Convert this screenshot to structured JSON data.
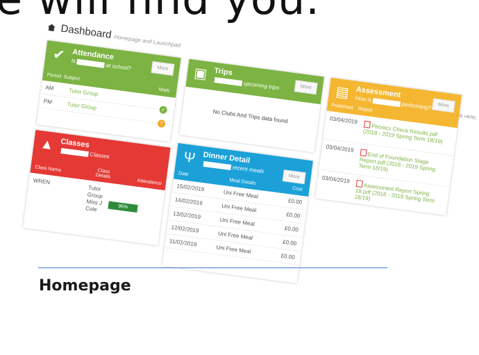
{
  "headline": "e will find you.",
  "dashboard": {
    "title": "Dashboard",
    "subtitle": "Homepage and Launchpad",
    "breadcrumb": "YOU ARE HERE:"
  },
  "attendance": {
    "title": "Attendance",
    "subtitle_pre": "Is",
    "subtitle_post": "at school?",
    "more": "More",
    "col_period": "Period",
    "col_subject": "Subject",
    "col_mark": "Mark",
    "rows": [
      {
        "period": "AM",
        "subject": "Tutor Group",
        "mark_icon": "check-icon",
        "color": "#7cb342"
      },
      {
        "period": "PM",
        "subject": "Tutor Group",
        "mark_icon": "question-icon",
        "color": "#f5a623"
      }
    ]
  },
  "classes": {
    "title": "Classes",
    "subtitle_post": "Classes",
    "col_name": "Class Name",
    "col_details": "Class Details",
    "col_attendance": "Attendance",
    "row": {
      "name": "WREN",
      "d1": "Tutor",
      "d2": "Group",
      "d3": "Miss J",
      "d4": "Cole",
      "attendance": "96%",
      "attendance_value": 96
    }
  },
  "trips": {
    "title": "Trips",
    "subtitle_post": "upcoming trips",
    "more": "More",
    "empty": "No Clubs And Trips data found"
  },
  "dinner": {
    "title": "Dinner Detail",
    "subtitle_post": "recent meals",
    "more": "More",
    "col_date": "Date",
    "col_meal": "Meal Details",
    "col_cost": "Cost",
    "rows": [
      {
        "date": "15/02/2019",
        "meal": "Uni Free Meal",
        "cost": "£0.00"
      },
      {
        "date": "14/02/2019",
        "meal": "Uni Free Meal",
        "cost": "£0.00"
      },
      {
        "date": "13/02/2019",
        "meal": "Uni Free Meal",
        "cost": "£0.00"
      },
      {
        "date": "12/02/2019",
        "meal": "Uni Free Meal",
        "cost": "£0.00"
      },
      {
        "date": "11/02/2019",
        "meal": "Uni Free Meal",
        "cost": "£0.00"
      }
    ]
  },
  "assessment": {
    "title": "Assessment",
    "subtitle_pre": "How is",
    "subtitle_post": "performing?",
    "more": "More",
    "col_published": "Published",
    "col_report": "Report",
    "rows": [
      {
        "date": "03/04/2019",
        "report": "Phonics Check Results.pdf (2018 - 2019 Spring Term 18/19)"
      },
      {
        "date": "03/04/2019",
        "report": "End of Foundation Stage Report.pdf (2018 - 2019 Spring Term 18/19)"
      },
      {
        "date": "03/04/2019",
        "report": "Assessment Report Spring 19.pdf (2018 - 2019 Spring Term 18/19)"
      }
    ]
  },
  "caption": "Homepage",
  "colors": {
    "green": "#7cb342",
    "red": "#e53935",
    "blue": "#1ba1d8",
    "orange": "#f5b731"
  }
}
